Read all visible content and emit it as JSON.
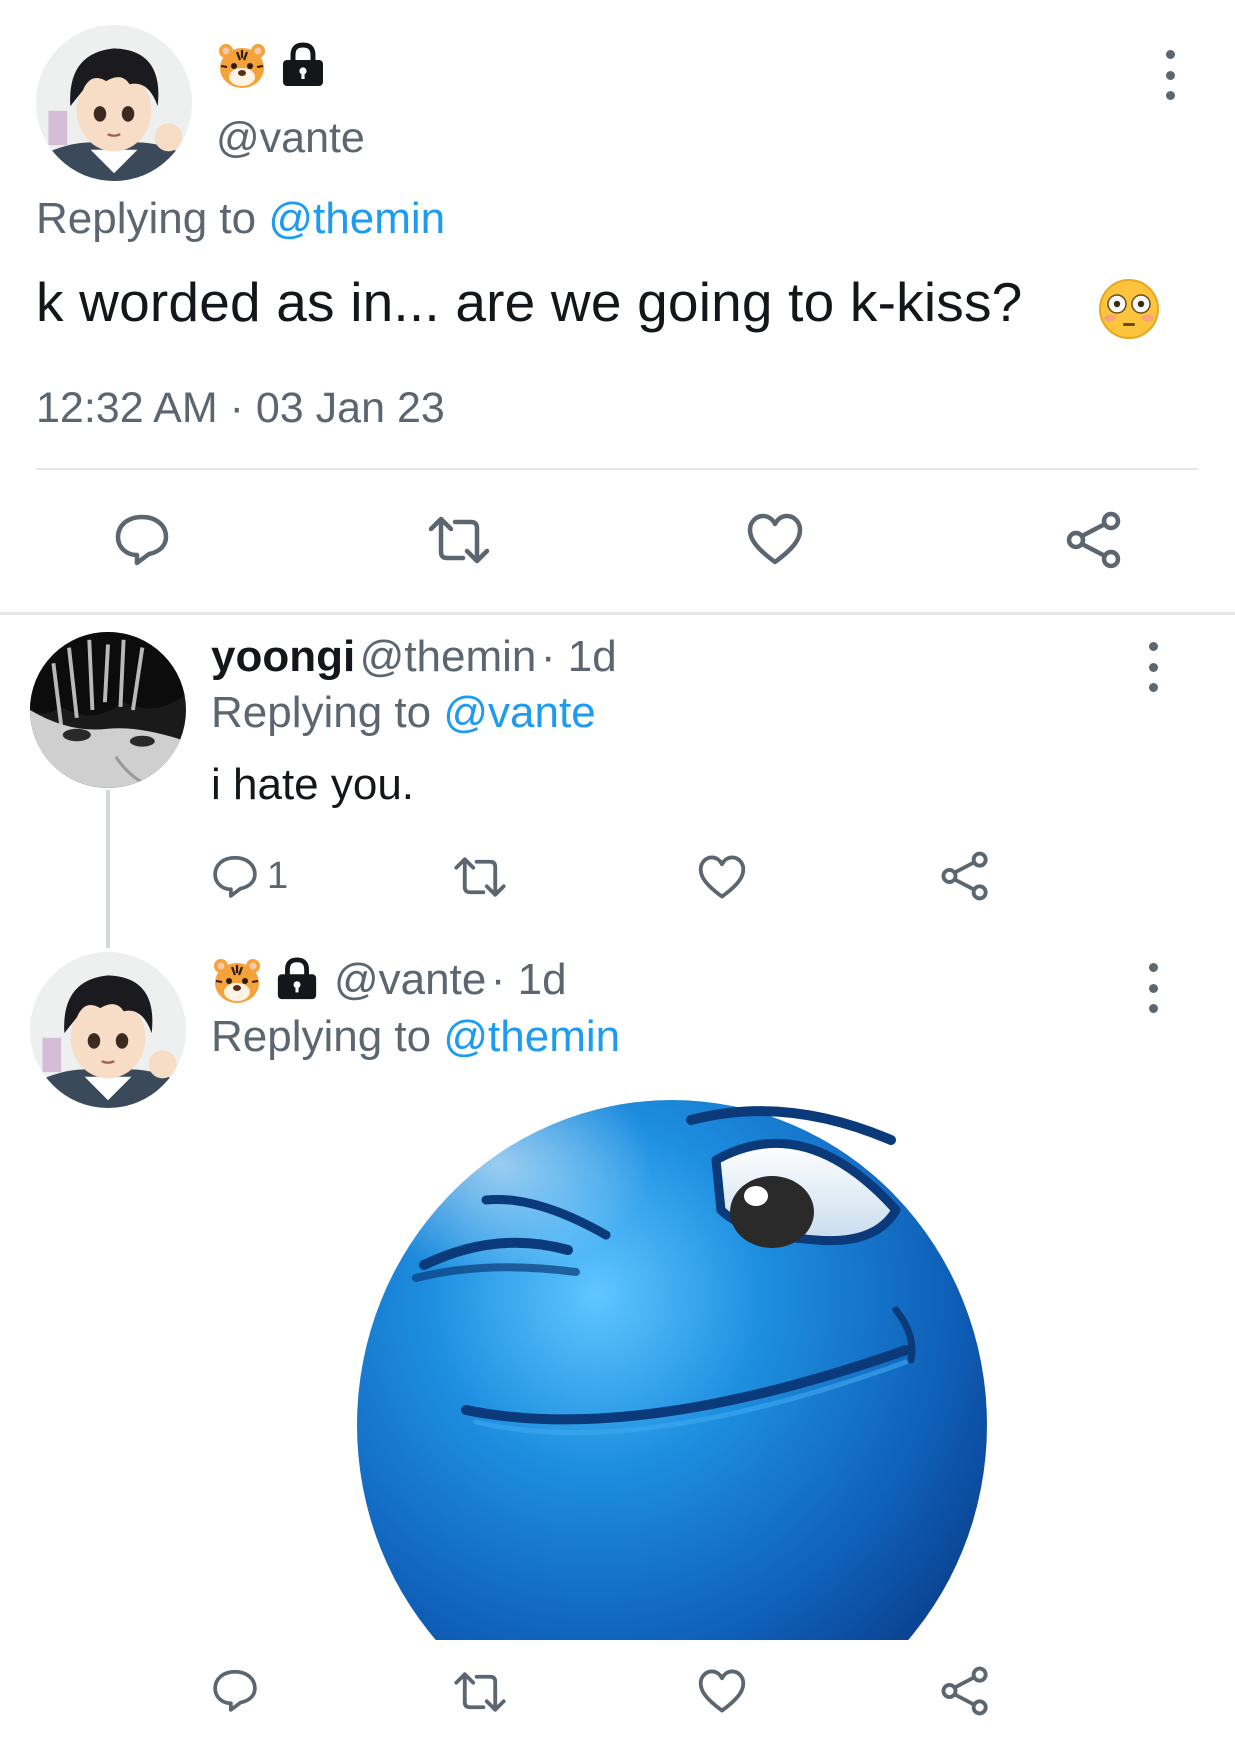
{
  "main_tweet": {
    "handle": "@vante",
    "badges": [
      "tiger-emoji",
      "lock-icon"
    ],
    "replying_prefix": "Replying to",
    "replying_to": "@themin",
    "text": "k worded as in... are we going to k-kiss?",
    "text_emoji": "flushed-face-emoji",
    "timestamp": "12:32 AM · 03 Jan 23",
    "actions": [
      "reply-icon",
      "retweet-icon",
      "like-icon",
      "share-icon"
    ]
  },
  "replies": [
    {
      "name": "yoongi",
      "handle": "@themin",
      "time": "· 1d",
      "replying_prefix": "Replying to",
      "replying_to": "@vante",
      "text": "i hate you.",
      "reply_count": "1"
    },
    {
      "badges": [
        "tiger-emoji",
        "lock-icon"
      ],
      "handle": "@vante",
      "time": "· 1d",
      "replying_prefix": "Replying to",
      "replying_to": "@themin",
      "media": "blue-winking-smiley-image"
    }
  ],
  "colors": {
    "accent": "#1d9bf0",
    "secondary_text": "#5b6670",
    "primary_text": "#14171a",
    "divider": "#e3e6e8"
  }
}
